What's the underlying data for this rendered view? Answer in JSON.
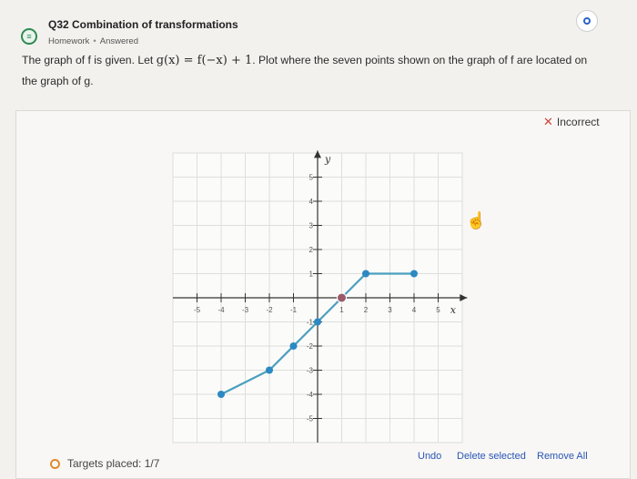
{
  "header": {
    "title": "Q32 Combination of transformations",
    "category": "Homework",
    "status": "Answered",
    "icon": "assignment-list-icon",
    "info_icon": "info-circle-icon"
  },
  "prompt": {
    "text1": "The graph of f is given. Let ",
    "formula": "g(x) = f(−x) + 1",
    "text2": ". Plot where the seven points shown on the graph of f are located on the graph of g."
  },
  "result": {
    "label": "Incorrect",
    "color": "#d0423c"
  },
  "graph": {
    "x_label": "x",
    "y_label": "y",
    "x_ticks": [
      "-5",
      "-4",
      "-3",
      "-2",
      "-1",
      "1",
      "2",
      "3",
      "4",
      "5"
    ],
    "y_ticks": [
      "5",
      "4",
      "3",
      "2",
      "1",
      "-1",
      "-2",
      "-3",
      "-4",
      "-5"
    ],
    "line_color": "#4a9fbe",
    "point_color": "#2c89c2",
    "placed_point_color": "#9b5a6a",
    "points": [
      {
        "x": -4,
        "y": -4
      },
      {
        "x": -2,
        "y": -3
      },
      {
        "x": -1,
        "y": -2
      },
      {
        "x": 0,
        "y": -1
      },
      {
        "x": 1,
        "y": 0
      },
      {
        "x": 2,
        "y": 1
      },
      {
        "x": 4,
        "y": 1
      }
    ],
    "placed_point": {
      "x": 1,
      "y": 0
    }
  },
  "footer": {
    "targets_placed": "Targets placed: 1/7",
    "undo": "Undo",
    "delete_selected": "Delete selected",
    "remove_all": "Remove All"
  }
}
